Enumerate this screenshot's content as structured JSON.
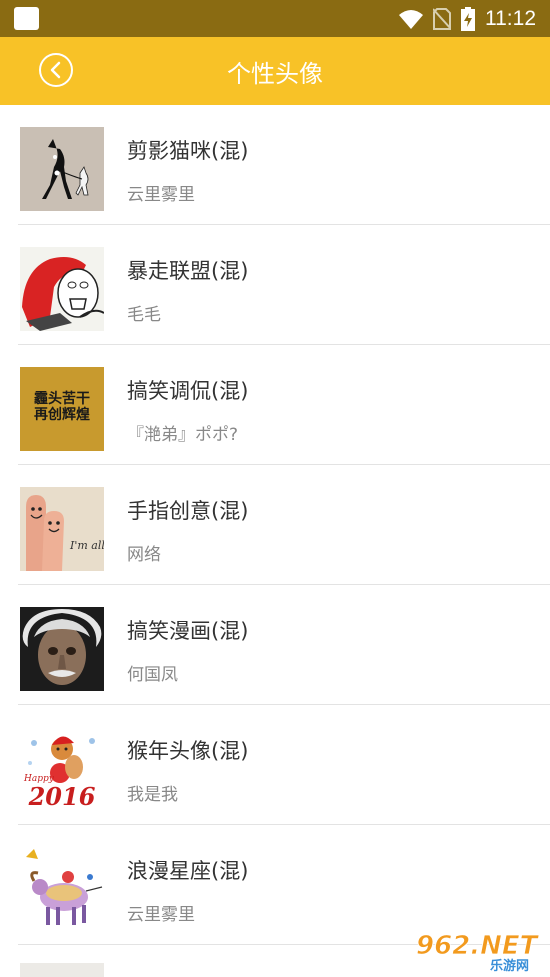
{
  "status_bar": {
    "time": "11:12"
  },
  "header": {
    "title": "个性头像"
  },
  "items": [
    {
      "name": "剪影猫咪(混)",
      "author": "云里雾里",
      "thumb_bg": "#c9bfb4"
    },
    {
      "name": "暴走联盟(混)",
      "author": "毛毛",
      "thumb_bg": "#f3f3ee"
    },
    {
      "name": "搞笑调侃(混)",
      "author": "『滟弟』ポポ?",
      "thumb_bg": "#c89a2e",
      "thumb_text_1": "霾头苦干",
      "thumb_text_2": "再创辉煌"
    },
    {
      "name": "手指创意(混)",
      "author": "网络",
      "thumb_bg": "#e8ddcb",
      "thumb_text": "I'm all y"
    },
    {
      "name": "搞笑漫画(混)",
      "author": "何国凤",
      "thumb_bg": "#1c1c1c"
    },
    {
      "name": "猴年头像(混)",
      "author": "我是我",
      "thumb_bg": "#ffffff",
      "thumb_text_1": "Happy",
      "thumb_text_2": "2016"
    },
    {
      "name": "浪漫星座(混)",
      "author": "云里雾里",
      "thumb_bg": "#ffffff"
    }
  ],
  "watermark": {
    "text": "962.NET",
    "sub": "乐游网"
  }
}
